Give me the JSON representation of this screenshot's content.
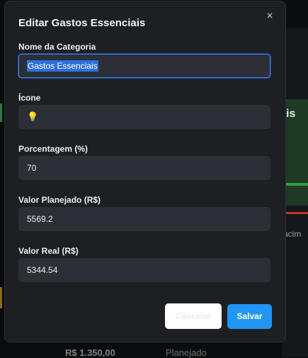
{
  "background": {
    "right_heading_fragment": "is",
    "right_label_fragment": "acim",
    "bottom_left_value": "R$ 1.350,00",
    "bottom_right_label": "Planejado"
  },
  "modal": {
    "title": "Editar Gastos Essenciais",
    "close_glyph": "×",
    "fields": [
      {
        "label": "Nome da Categoria",
        "value": "Gastos Essenciais"
      },
      {
        "label": "Ícone",
        "value": "💡",
        "icon": "lightbulb-icon"
      },
      {
        "label": "Porcentagem (%)",
        "value": "70"
      },
      {
        "label": "Valor Planejado (R$)",
        "value": "5569.2"
      },
      {
        "label": "Valor Real (R$)",
        "value": "5344.54"
      }
    ],
    "cancel_label": "Cancelar",
    "save_label": "Salvar"
  },
  "colors": {
    "accent": "#2196f3",
    "focus_border": "#3b82f6",
    "modal_bg": "#1d1f23",
    "input_bg": "#2c2f35"
  }
}
